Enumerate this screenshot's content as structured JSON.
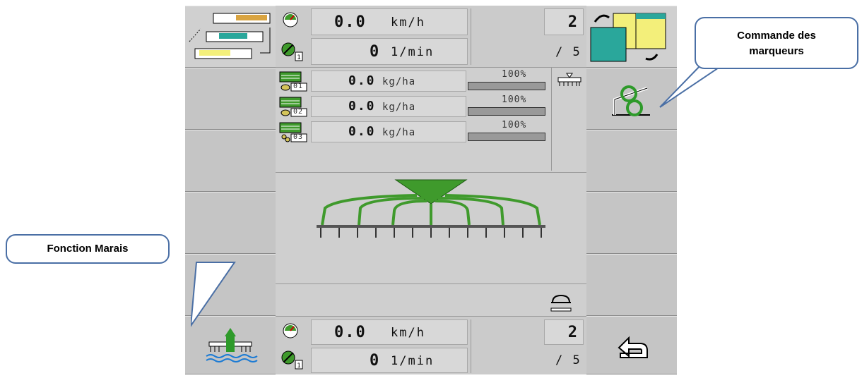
{
  "top_bar": {
    "speed_value": "0.0",
    "speed_unit": "km/h",
    "rpm_value": "0",
    "rpm_unit": "1/min",
    "gear_current": "2",
    "gear_total": "/ 5",
    "pump_badge": "1"
  },
  "rates": [
    {
      "id": "01",
      "value": "0.0",
      "unit": "kg/ha",
      "percent": "100%"
    },
    {
      "id": "02",
      "value": "0.0",
      "unit": "kg/ha",
      "percent": "100%"
    },
    {
      "id": "03",
      "value": "0.0",
      "unit": "kg/ha",
      "percent": "100%"
    }
  ],
  "bottom_bar": {
    "speed_value": "0.0",
    "speed_unit": "km/h",
    "rpm_value": "0",
    "rpm_unit": "1/min",
    "gear_current": "2",
    "gear_total": "/ 5",
    "pump_badge": "1"
  },
  "callouts": {
    "markers": "Commande des marqueurs",
    "marsh": "Fonction Marais"
  },
  "colors": {
    "accent_green": "#3f9a2c",
    "panel_gray": "#c8c8c8",
    "callout_border": "#4a6fa5"
  }
}
